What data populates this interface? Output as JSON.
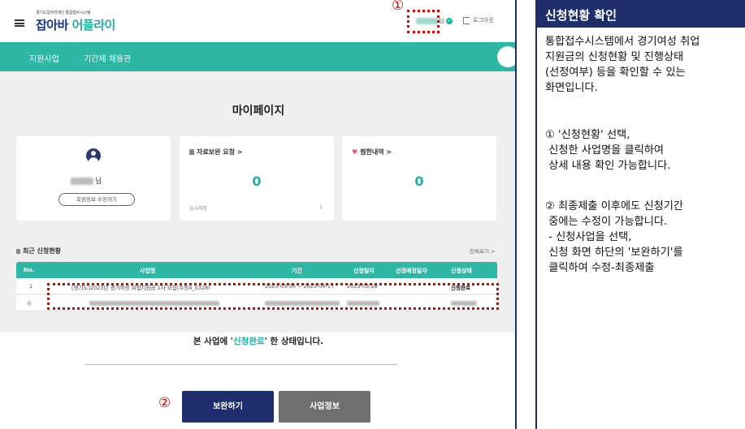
{
  "app": {
    "logo_subtitle": "경기도일자리재단 통합접수시스템",
    "logo_part1": "잡아바",
    "logo_part2": " 어플라이",
    "user_suffix": "님",
    "logout_label": "로그아웃",
    "check_glyph": "✓",
    "dot_sep": "·"
  },
  "nav": {
    "items": [
      "지원사업",
      "기간제 채용관"
    ]
  },
  "mypage": {
    "title": "마이페이지",
    "name_suffix": "님",
    "edit_profile": "회원정보 수정하기",
    "card_docs_label": "자료보완 요청 >",
    "card_docs_count": "0",
    "temp_save_label": "임시저장",
    "temp_save_count": "1",
    "card_wish_label": "찜한내역 >",
    "card_wish_count": "0"
  },
  "recent": {
    "title": "최근 신청현황",
    "see_all": "전체보기 >",
    "columns": [
      "No.",
      "사업명",
      "기간",
      "신청일자",
      "선정예정일자",
      "신청상태"
    ],
    "rows": [
      {
        "no": "1",
        "name": "[경기도]2023년 경기여성 취업지원금 1차 모집(수정4_0328)",
        "period": "2023-03-30 ~ 2023-04-17",
        "applied": "2023-03-28",
        "status": "신청완료"
      }
    ]
  },
  "status": {
    "prefix": "본 사업에 '",
    "highlight": "신청완료",
    "suffix": "' 한 상태입니다."
  },
  "buttons": {
    "supplement": "보완하기",
    "business_info": "사업정보"
  },
  "annotations": {
    "marker1": "①",
    "marker2": "②"
  },
  "description": {
    "title": "신청현황 확인",
    "lines": [
      "통합접수시스템에서 경기여성 취업",
      "지원금의 신청현황 및 진행상태",
      "(선정여부) 등을 확인할 수 있는",
      "화면입니다.",
      "① '신청현황' 선택,",
      " 신청한 사업명을 클릭하여",
      " 상세 내용 확인 가능합니다.",
      "② 최종제출 이후에도 신청기간",
      " 중에는 수정이 가능합니다.",
      " - 신청사업을 선택,",
      " 신청 화면 하단의 '보완하기'를",
      " 클릭하여 수정-최종제출"
    ]
  },
  "colors": {
    "navy": "#1f2f6b",
    "teal": "#2fb7a5",
    "annotation_red": "#e00000"
  }
}
